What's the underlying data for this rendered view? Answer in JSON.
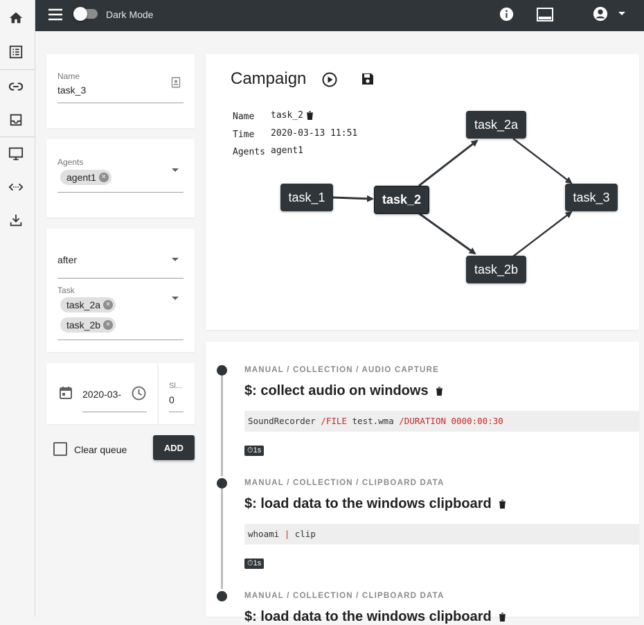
{
  "topbar": {
    "dark_mode_label": "Dark Mode"
  },
  "form": {
    "name_label": "Name",
    "name_value": "task_3",
    "agents_label": "Agents",
    "agents": [
      "agent1"
    ],
    "dependency_value": "after",
    "task_label": "Task",
    "tasks": [
      "task_2a",
      "task_2b"
    ],
    "date_value": "2020-03-",
    "sleep_label": "Sl...",
    "sleep_value": "0",
    "clear_queue_label": "Clear queue",
    "add_button": "ADD"
  },
  "campaign": {
    "title": "Campaign",
    "info_labels": {
      "name": "Name",
      "time": "Time",
      "agents": "Agents"
    },
    "info_values": {
      "name": "task_2",
      "time": "2020-03-13 11:51",
      "agents": "agent1"
    },
    "graph": {
      "nodes": [
        "task_1",
        "task_2",
        "task_2a",
        "task_2b",
        "task_3"
      ],
      "selected": "task_2"
    }
  },
  "timeline": [
    {
      "crumb": "MANUAL / COLLECTION / AUDIO CAPTURE",
      "title": "$: collect audio on windows",
      "code": [
        {
          "t": "SoundRecorder ",
          "k": false
        },
        {
          "t": "/FILE",
          "k": true
        },
        {
          "t": " test.wma ",
          "k": false
        },
        {
          "t": "/DURATION",
          "k": true
        },
        {
          "t": " ",
          "k": false
        },
        {
          "t": "0000:00:30",
          "k": true
        }
      ],
      "duration": "⏱1s"
    },
    {
      "crumb": "MANUAL / COLLECTION / CLIPBOARD DATA",
      "title": "$: load data to the windows clipboard",
      "code": [
        {
          "t": "whoami ",
          "k": false
        },
        {
          "t": "|",
          "k": true
        },
        {
          "t": " clip",
          "k": false
        }
      ],
      "duration": "⏱1s"
    },
    {
      "crumb": "MANUAL / COLLECTION / CLIPBOARD DATA",
      "title": "$: load data to the windows clipboard"
    }
  ],
  "colors": {
    "dark": "#30353a",
    "accent_red": "#c62828"
  },
  "icons": [
    "home-icon",
    "list-icon",
    "link-icon",
    "inbox-icon",
    "monitor-icon",
    "code-icon",
    "download-icon",
    "menu-icon",
    "info-icon",
    "keyboard-icon",
    "account-icon",
    "play-circle-icon",
    "save-icon",
    "trash-icon",
    "calendar-icon",
    "clock-icon",
    "badge-icon"
  ]
}
